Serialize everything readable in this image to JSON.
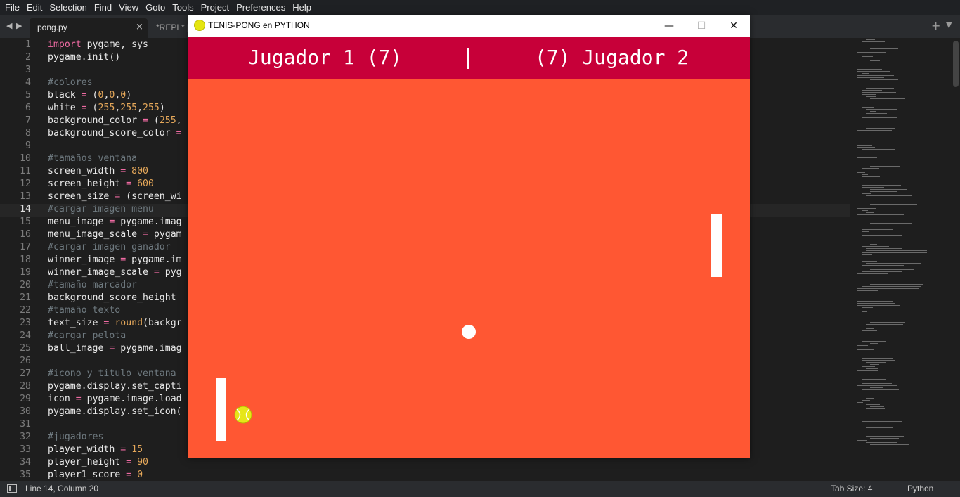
{
  "menu": [
    "File",
    "Edit",
    "Selection",
    "Find",
    "View",
    "Goto",
    "Tools",
    "Project",
    "Preferences",
    "Help"
  ],
  "tabs": {
    "active": {
      "label": "pong.py",
      "close": "×"
    },
    "second": {
      "label": "*REPL* [py"
    },
    "plus": "+",
    "nav_left": "◀",
    "nav_right": "▶",
    "overflow": "▼"
  },
  "editor": {
    "current_line": 14,
    "lines": [
      {
        "n": "1",
        "html": "<span class='k'>import</span> pygame, sys"
      },
      {
        "n": "2",
        "html": "pygame.init()"
      },
      {
        "n": "3",
        "html": ""
      },
      {
        "n": "4",
        "html": "<span class='c'>#colores</span>"
      },
      {
        "n": "5",
        "html": "black <span class='o'>=</span> (<span class='n'>0</span>,<span class='n'>0</span>,<span class='n'>0</span>)"
      },
      {
        "n": "6",
        "html": "white <span class='o'>=</span> (<span class='n'>255</span>,<span class='n'>255</span>,<span class='n'>255</span>)"
      },
      {
        "n": "7",
        "html": "background_color <span class='o'>=</span> (<span class='n'>255</span>,"
      },
      {
        "n": "8",
        "html": "background_score_color <span class='o'>=</span>"
      },
      {
        "n": "9",
        "html": ""
      },
      {
        "n": "10",
        "html": "<span class='c'>#tamaños ventana</span>"
      },
      {
        "n": "11",
        "html": "screen_width <span class='o'>=</span> <span class='n'>800</span>"
      },
      {
        "n": "12",
        "html": "screen_height <span class='o'>=</span> <span class='n'>600</span>"
      },
      {
        "n": "13",
        "html": "screen_size <span class='o'>=</span> (screen_wi"
      },
      {
        "n": "14",
        "html": "<span class='c'>#cargar imagen menu</span>"
      },
      {
        "n": "15",
        "html": "menu_image <span class='o'>=</span> pygame.imag"
      },
      {
        "n": "16",
        "html": "menu_image_scale <span class='o'>=</span> pygam"
      },
      {
        "n": "17",
        "html": "<span class='c'>#cargar imagen ganador</span>"
      },
      {
        "n": "18",
        "html": "winner_image <span class='o'>=</span> pygame.im"
      },
      {
        "n": "19",
        "html": "winner_image_scale <span class='o'>=</span> pyg"
      },
      {
        "n": "20",
        "html": "<span class='c'>#tamaño marcador</span>"
      },
      {
        "n": "21",
        "html": "background_score_height"
      },
      {
        "n": "22",
        "html": "<span class='c'>#tamaño texto</span>"
      },
      {
        "n": "23",
        "html": "text_size <span class='o'>=</span> <span class='f'>round</span>(backgr"
      },
      {
        "n": "24",
        "html": "<span class='c'>#cargar pelota</span>"
      },
      {
        "n": "25",
        "html": "ball_image <span class='o'>=</span> pygame.imag"
      },
      {
        "n": "26",
        "html": ""
      },
      {
        "n": "27",
        "html": "<span class='c'>#icono y titulo ventana</span>"
      },
      {
        "n": "28",
        "html": "pygame.display.set_capti"
      },
      {
        "n": "29",
        "html": "icon <span class='o'>=</span> pygame.image.load"
      },
      {
        "n": "30",
        "html": "pygame.display.set_icon("
      },
      {
        "n": "31",
        "html": ""
      },
      {
        "n": "32",
        "html": "<span class='c'>#jugadores</span>"
      },
      {
        "n": "33",
        "html": "player_width <span class='o'>=</span> <span class='n'>15</span>"
      },
      {
        "n": "34",
        "html": "player_height <span class='o'>=</span> <span class='n'>90</span>"
      },
      {
        "n": "35",
        "html": "player1_score <span class='o'>=</span> <span class='n'>0</span>"
      }
    ]
  },
  "status": {
    "position": "Line 14, Column 20",
    "tab_size": "Tab Size: 4",
    "syntax": "Python"
  },
  "game": {
    "title": "TENIS-PONG en PYTHON",
    "controls": {
      "minimize": "—",
      "maximize": "☐",
      "close": "✕"
    },
    "score_left": "Jugador 1 (7)",
    "score_right": "(7) Jugador 2",
    "colors": {
      "background": "#ff5733",
      "score_bar": "#c70039",
      "pieces": "#ffffff"
    }
  }
}
